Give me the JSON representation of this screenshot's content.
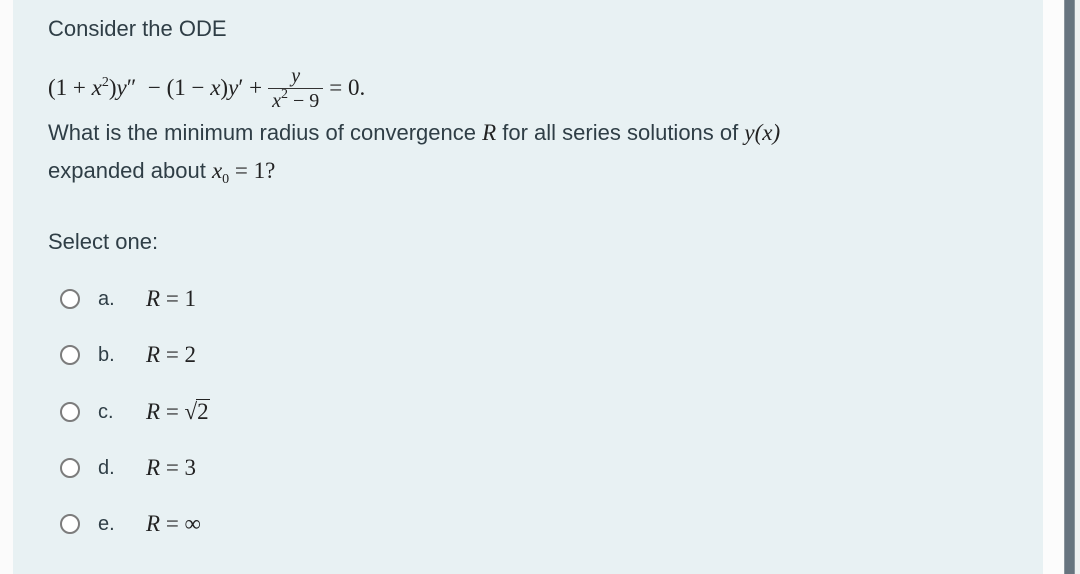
{
  "question": {
    "intro": "Consider the ODE",
    "equation": {
      "lhs_part1": "(1 + ",
      "x": "x",
      "sq": "2",
      "lhs_part2": ")",
      "y": "y",
      "ypp_prime": "″",
      "minus": " − (1 − ",
      "x2": "x",
      "lhs_part3": ")",
      "y2": "y",
      "yp_prime": "′",
      "plus": " +",
      "frac_num": "y",
      "frac_den_x": "x",
      "frac_den_sq": "2",
      "frac_den_rest": " − 9",
      "rhs": "= 0."
    },
    "prompt_part1": "What is the minimum radius of convergence ",
    "prompt_R": "R",
    "prompt_part2": " for all series solutions of ",
    "prompt_yx": "y(x)",
    "prompt_line2_part1": "expanded about ",
    "prompt_x0": "x",
    "prompt_x0_sub": "0",
    "prompt_line2_part2": " = 1?"
  },
  "select_label": "Select one:",
  "options": [
    {
      "letter": "a.",
      "var": "R",
      "rel": " = ",
      "value": "1",
      "selected": false
    },
    {
      "letter": "b.",
      "var": "R",
      "rel": " = ",
      "value": "2",
      "selected": false
    },
    {
      "letter": "c.",
      "var": "R",
      "rel": " = ",
      "sqrt_symbol": "√",
      "value": "2",
      "selected": false
    },
    {
      "letter": "d.",
      "var": "R",
      "rel": " = ",
      "value": "3",
      "selected": false
    },
    {
      "letter": "e.",
      "var": "R",
      "rel": " = ",
      "value": "∞",
      "selected": false
    }
  ]
}
